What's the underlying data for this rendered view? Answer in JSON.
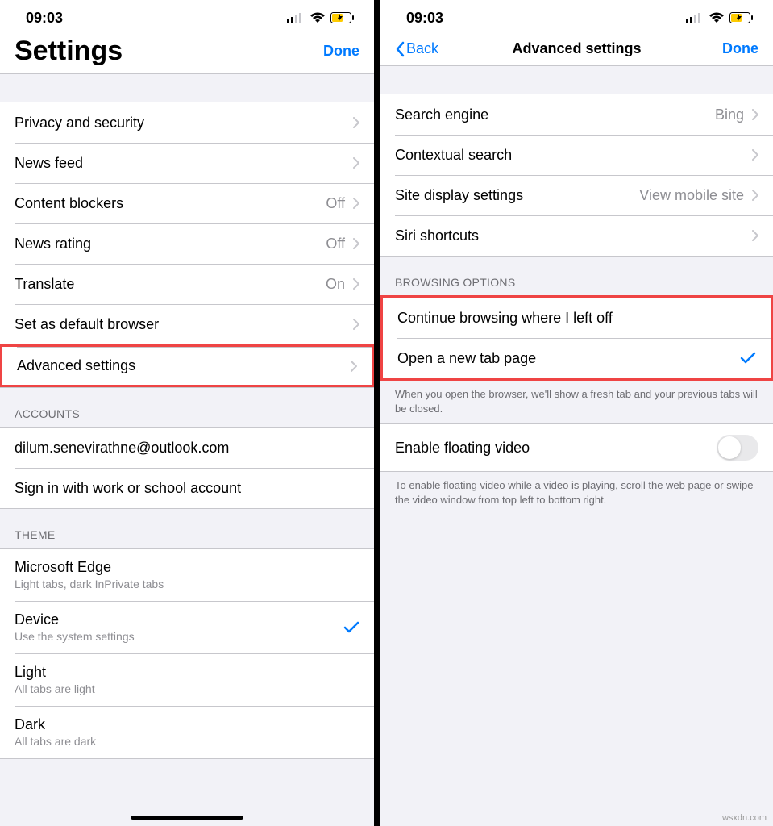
{
  "status": {
    "time": "09:03"
  },
  "left": {
    "title": "Settings",
    "done": "Done",
    "items": [
      {
        "label": "Privacy and security"
      },
      {
        "label": "News feed"
      },
      {
        "label": "Content blockers",
        "value": "Off"
      },
      {
        "label": "News rating",
        "value": "Off"
      },
      {
        "label": "Translate",
        "value": "On"
      },
      {
        "label": "Set as default browser"
      },
      {
        "label": "Advanced settings"
      }
    ],
    "accounts_header": "ACCOUNTS",
    "accounts": [
      {
        "label": "dilum.senevirathne@outlook.com"
      },
      {
        "label": "Sign in with work or school account"
      }
    ],
    "theme_header": "THEME",
    "themes": [
      {
        "label": "Microsoft Edge",
        "sub": "Light tabs, dark InPrivate tabs"
      },
      {
        "label": "Device",
        "sub": "Use the system settings"
      },
      {
        "label": "Light",
        "sub": "All tabs are light"
      },
      {
        "label": "Dark",
        "sub": "All tabs are dark"
      }
    ]
  },
  "right": {
    "back": "Back",
    "title": "Advanced settings",
    "done": "Done",
    "items": [
      {
        "label": "Search engine",
        "value": "Bing"
      },
      {
        "label": "Contextual search"
      },
      {
        "label": "Site display settings",
        "value": "View mobile site"
      },
      {
        "label": "Siri shortcuts"
      }
    ],
    "browsing_header": "BROWSING OPTIONS",
    "browsing": [
      {
        "label": "Continue browsing where I left off"
      },
      {
        "label": "Open a new tab page"
      }
    ],
    "browsing_footer": "When you open the browser, we'll show a fresh tab and your previous tabs will be closed.",
    "floating": {
      "label": "Enable floating video"
    },
    "floating_footer": "To enable floating video while a video is playing, scroll the web page or swipe the video window from top left to bottom right."
  },
  "watermark": "wsxdn.com"
}
